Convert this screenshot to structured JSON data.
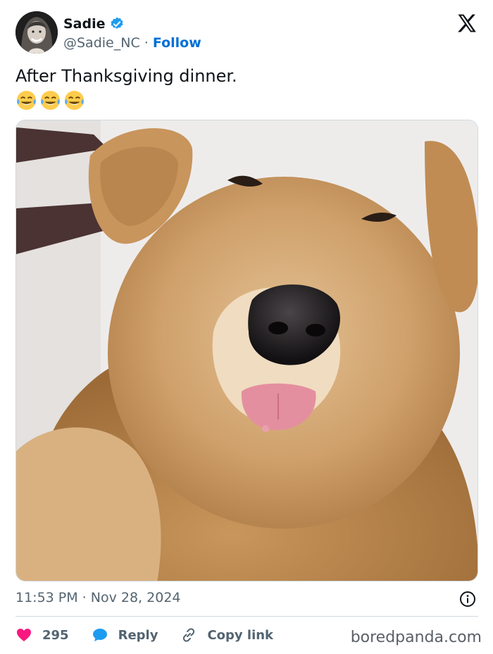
{
  "author": {
    "display_name": "Sadie",
    "handle": "@Sadie_NC",
    "separator": "·",
    "follow_label": "Follow",
    "verified": true
  },
  "tweet": {
    "text": "After Thanksgiving dinner.",
    "emoji": "😂😂😂"
  },
  "meta": {
    "timestamp": "11:53 PM · Nov 28, 2024"
  },
  "actions": {
    "like_count": "295",
    "reply_label": "Reply",
    "copy_link_label": "Copy link"
  },
  "watermark": "boredpanda.com",
  "icons": {
    "brand": "x-logo-icon",
    "verified": "verified-badge-icon",
    "like": "heart-icon",
    "reply": "speech-bubble-icon",
    "copy": "link-icon",
    "info": "info-icon"
  },
  "colors": {
    "accent": "#006fd6",
    "like": "#f91880",
    "verified": "#1d9bf0",
    "muted": "#536471"
  }
}
